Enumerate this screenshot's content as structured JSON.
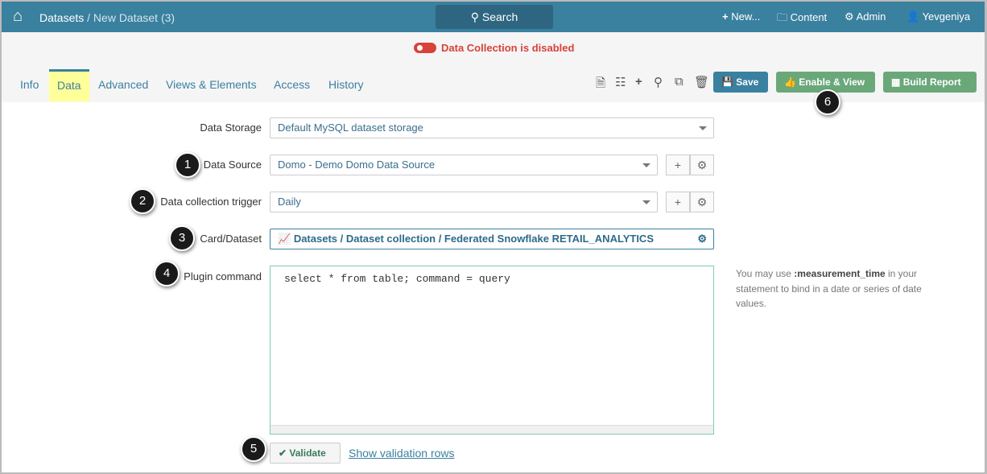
{
  "topbar": {
    "breadcrumb_root": "Datasets",
    "breadcrumb_sep": " / ",
    "breadcrumb_current": "New Dataset (3)",
    "search": "Search",
    "new": "New...",
    "content": "Content",
    "admin": "Admin",
    "user": "Yevgeniya"
  },
  "status": {
    "text": "Data Collection is disabled",
    "color": "#d9413a"
  },
  "tabs": [
    {
      "label": "Info"
    },
    {
      "label": "Data"
    },
    {
      "label": "Advanced"
    },
    {
      "label": "Views & Elements"
    },
    {
      "label": "Access"
    },
    {
      "label": "History"
    }
  ],
  "toolbar": {
    "save": "Save",
    "enable_view": "Enable & View",
    "build_report": "Build Report"
  },
  "form": {
    "data_storage": {
      "label": "Data Storage",
      "value": "Default MySQL dataset storage"
    },
    "data_source": {
      "label": "Data Source",
      "value": "Domo - Demo Domo Data Source"
    },
    "trigger": {
      "label": "Data collection trigger",
      "value": "Daily"
    },
    "card": {
      "label": "Card/Dataset",
      "value": "Datasets / Dataset collection / Federated Snowflake RETAIL_ANALYTICS"
    },
    "plugin": {
      "label": "Plugin command",
      "value": "select * from table; command = query"
    },
    "help_pre": "You may use ",
    "help_bold": ":measurement_time",
    "help_post": " in your statement to bind in a date or series of date values.",
    "validate": "Validate",
    "show_rows": "Show validation rows"
  },
  "callouts": [
    "1",
    "2",
    "3",
    "4",
    "5",
    "6"
  ]
}
